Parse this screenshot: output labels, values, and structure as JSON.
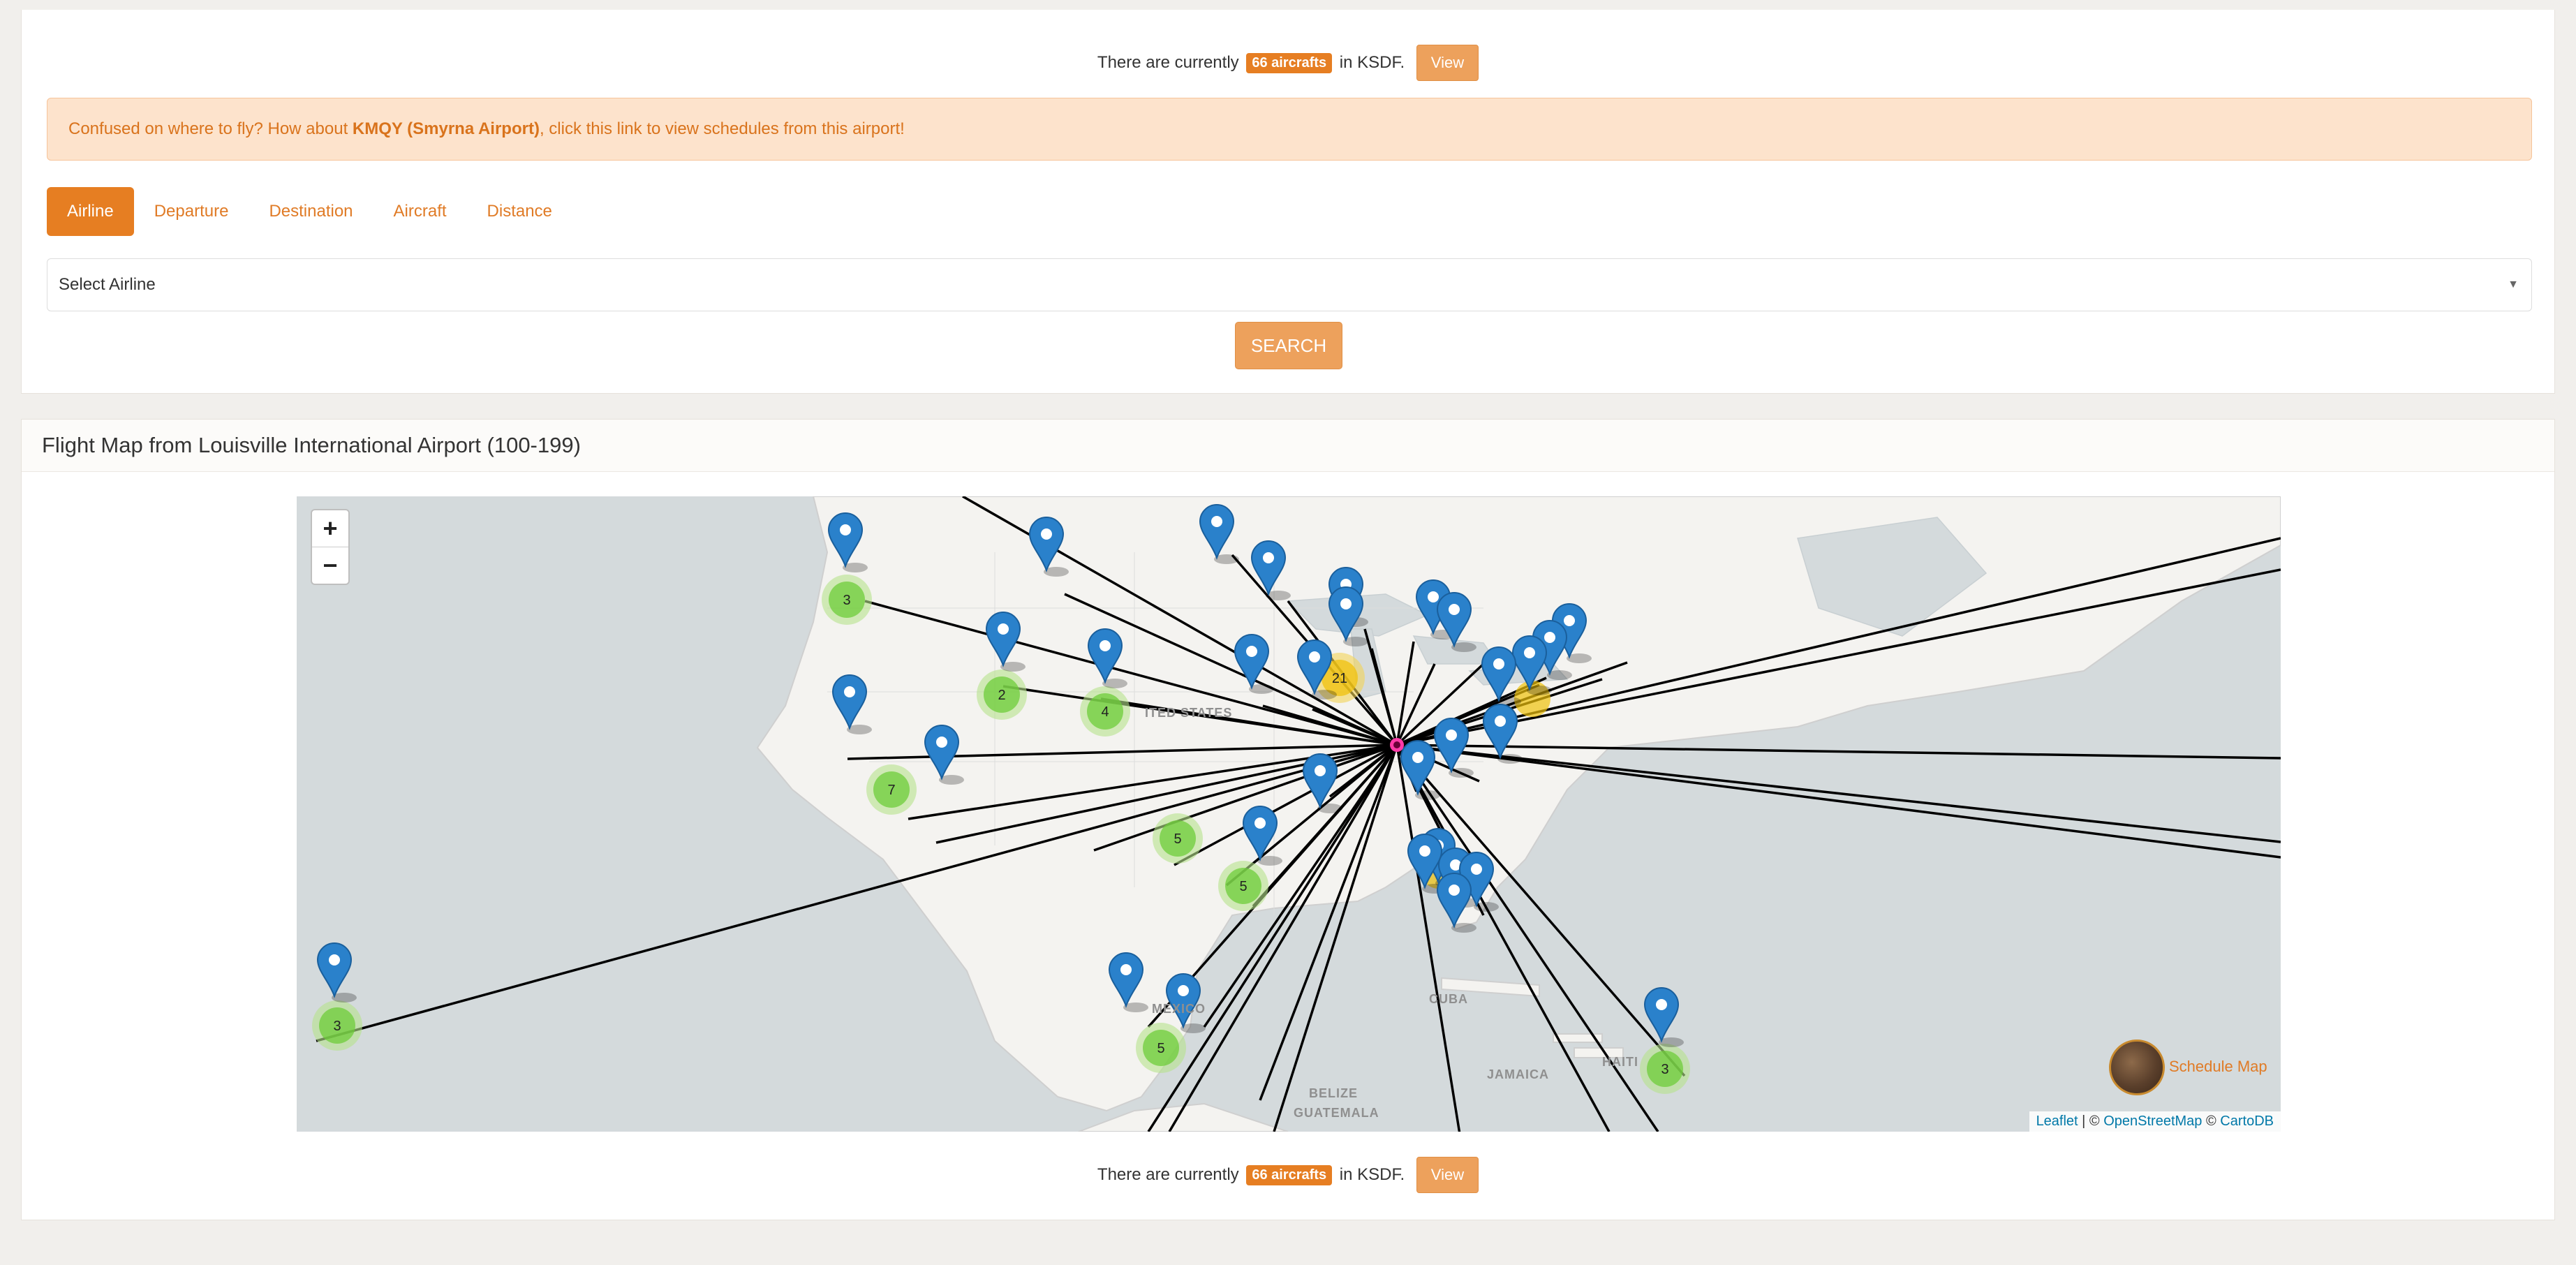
{
  "status": {
    "prefix": "There are currently",
    "badge": "66 aircrafts",
    "suffix": "in KSDF.",
    "view_label": "View"
  },
  "alert": {
    "prefix": "Confused on where to fly? How about",
    "airport": "KMQY (Smyrna Airport)",
    "suffix": ", click this link to view schedules from this airport!"
  },
  "tabs": [
    {
      "label": "Airline",
      "active": true
    },
    {
      "label": "Departure",
      "active": false
    },
    {
      "label": "Destination",
      "active": false
    },
    {
      "label": "Aircraft",
      "active": false
    },
    {
      "label": "Distance",
      "active": false
    }
  ],
  "airline_select": {
    "value": "Select Airline"
  },
  "search_label": "SEARCH",
  "map_panel": {
    "title": "Flight Map from Louisville International Airport (100-199)",
    "zoom_in": "+",
    "zoom_out": "−",
    "schedule_map_label": "Schedule Map",
    "attribution": {
      "leaflet": "Leaflet",
      "sep": " | © ",
      "osm": "OpenStreetMap",
      "sep2": " © ",
      "carto": "CartoDB"
    },
    "place_labels": [
      "ITED STATES",
      "CUBA",
      "MEXICO",
      "BELIZE",
      "GUATEMALA",
      "JAMAICA",
      "HAITI"
    ],
    "cluster_counts": [
      "3",
      "2",
      "4",
      "21",
      "7",
      "5",
      "5",
      "3",
      "5",
      "3"
    ]
  }
}
